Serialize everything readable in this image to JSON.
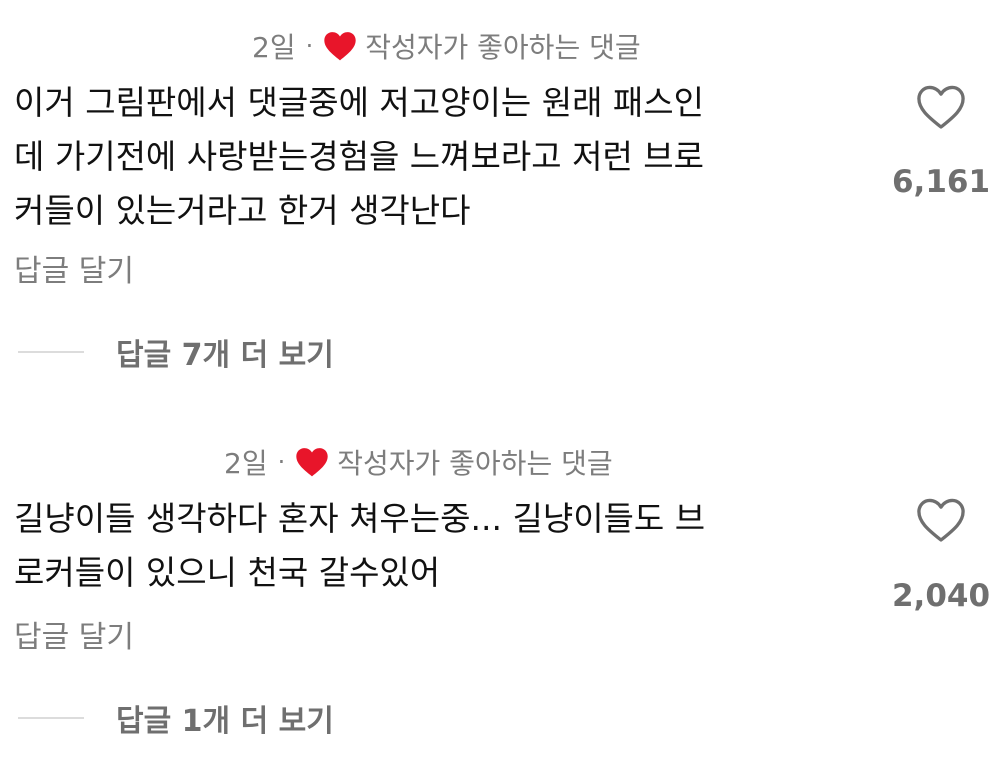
{
  "comments": [
    {
      "time": "2일",
      "separator": "·",
      "author_liked_label": "작성자가 좋아하는 댓글",
      "body_lines": [
        "이거 그림판에서 댓글중에 저고양이는 원래 패스인",
        "데 가기전에 사랑받는경험을 느껴보라고 저런 브로",
        "커들이 있는거라고 한거 생각난다"
      ],
      "reply_label": "답글 달기",
      "like_icon": "heart-outline-icon",
      "like_count": "6,161",
      "more_replies_label": "답글 7개 더 보기"
    },
    {
      "time": "2일",
      "separator": "·",
      "author_liked_label": "작성자가 좋아하는 댓글",
      "body_lines": [
        "길냥이들 생각하다 혼자 쳐우는중... 길냥이들도 브",
        "로커들이 있으니 천국 갈수있어"
      ],
      "reply_label": "답글 달기",
      "like_icon": "heart-outline-icon",
      "like_count": "2,040",
      "more_replies_label": "답글 1개 더 보기"
    }
  ],
  "colors": {
    "heart_badge": "#e8152a",
    "muted_text": "#7d7d7d",
    "body_text": "#111111",
    "divider_line": "#dcdcdc"
  }
}
